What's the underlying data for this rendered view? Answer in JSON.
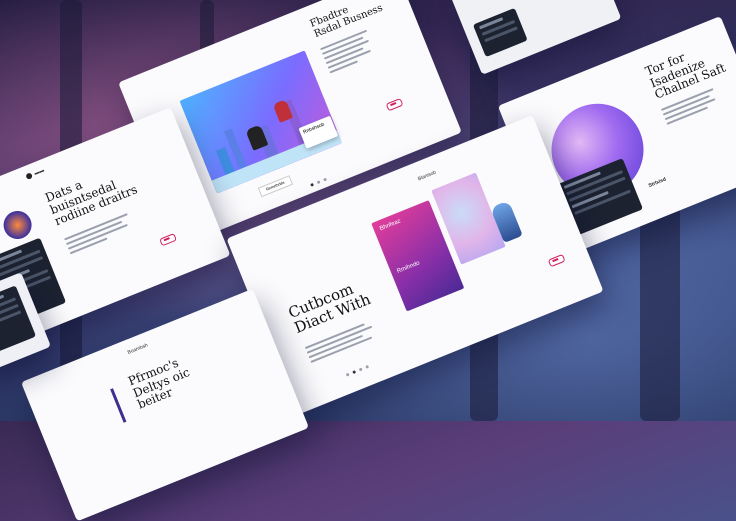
{
  "slides": {
    "top_center": {
      "title_lines": [
        "Fbadtre",
        "Rsdal Busness"
      ],
      "callout": "Rnbshsob",
      "caption": "Rnmrthrbls"
    },
    "top_right": {
      "title_lines": [
        "Tor for",
        "Isadenize",
        "Chalnel Saft"
      ],
      "caption": "Strlxisd"
    },
    "left": {
      "title_lines": [
        "Dats a",
        "buisntsedal",
        "rodiine draitrs"
      ]
    },
    "center": {
      "title_lines": [
        "Cutbcom",
        "Diact With"
      ],
      "tag": "Blanisob",
      "card1_label": "Bhnfeaz",
      "card2_label": "Rmihndo"
    },
    "bottom_left": {
      "title_lines": [
        "Pfrmoc's",
        "Deltys oic",
        "beiter"
      ],
      "tag": "Boarnbsh"
    }
  },
  "colors": {
    "accent": "#d0215f",
    "magenta": "#b23a9a",
    "violet": "#6c4ad9",
    "dashboard": "#1c2230"
  }
}
